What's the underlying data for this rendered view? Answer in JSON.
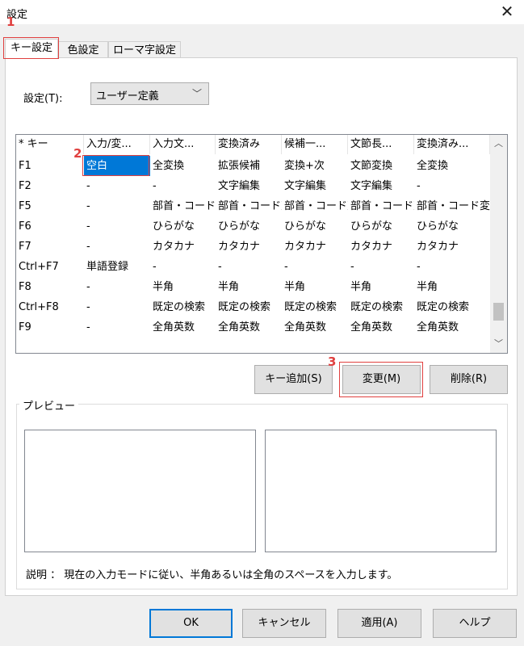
{
  "window": {
    "title": "設定"
  },
  "tabs": [
    {
      "label": "キー設定",
      "active": true
    },
    {
      "label": "色設定",
      "active": false
    },
    {
      "label": "ローマ字設定",
      "active": false
    }
  ],
  "setting": {
    "label": "設定(T):",
    "selected": "ユーザー定義"
  },
  "table": {
    "headers": [
      "* キー",
      "入力/変...",
      "入力文...",
      "変換済み",
      "候補一...",
      "文節長...",
      "変換済み..."
    ],
    "rows": [
      [
        "F1",
        "空白",
        "全変換",
        "拡張候補",
        "変換+次",
        "文節変換",
        "全変換"
      ],
      [
        "F2",
        "-",
        "-",
        "文字編集",
        "文字編集",
        "文字編集",
        "-"
      ],
      [
        "F5",
        "-",
        "部首・コード変換",
        "部首・コード変換",
        "部首・コード変換",
        "部首・コード変換",
        "部首・コード変換"
      ],
      [
        "F6",
        "-",
        "ひらがな",
        "ひらがな",
        "ひらがな",
        "ひらがな",
        "ひらがな"
      ],
      [
        "F7",
        "-",
        "カタカナ",
        "カタカナ",
        "カタカナ",
        "カタカナ",
        "カタカナ"
      ],
      [
        "Ctrl+F7",
        "単語登録",
        "-",
        "-",
        "-",
        "-",
        "-"
      ],
      [
        "F8",
        "-",
        "半角",
        "半角",
        "半角",
        "半角",
        "半角"
      ],
      [
        "Ctrl+F8",
        "-",
        "既定の検索",
        "既定の検索",
        "既定の検索",
        "既定の検索",
        "既定の検索"
      ],
      [
        "F9",
        "-",
        "全角英数",
        "全角英数",
        "全角英数",
        "全角英数",
        "全角英数"
      ]
    ]
  },
  "buttons": {
    "add_key": "キー追加(S)",
    "change": "変更(M)",
    "delete": "削除(R)",
    "ok": "OK",
    "cancel": "キャンセル",
    "apply": "適用(A)",
    "help": "ヘルプ"
  },
  "preview": {
    "label": "プレビュー"
  },
  "description": "説明 ： 現在の入力モードに従い、半角あるいは全角のスペースを入力します。",
  "annotations": {
    "step1": "1",
    "step2": "2",
    "step3": "3"
  },
  "colors": {
    "accent": "#0078d7",
    "highlight": "#e0403f"
  },
  "icons": {
    "close": "close-icon",
    "dropdown": "chevron-down-icon",
    "scroll_up": "chevron-up-icon",
    "scroll_down": "chevron-down-icon"
  }
}
